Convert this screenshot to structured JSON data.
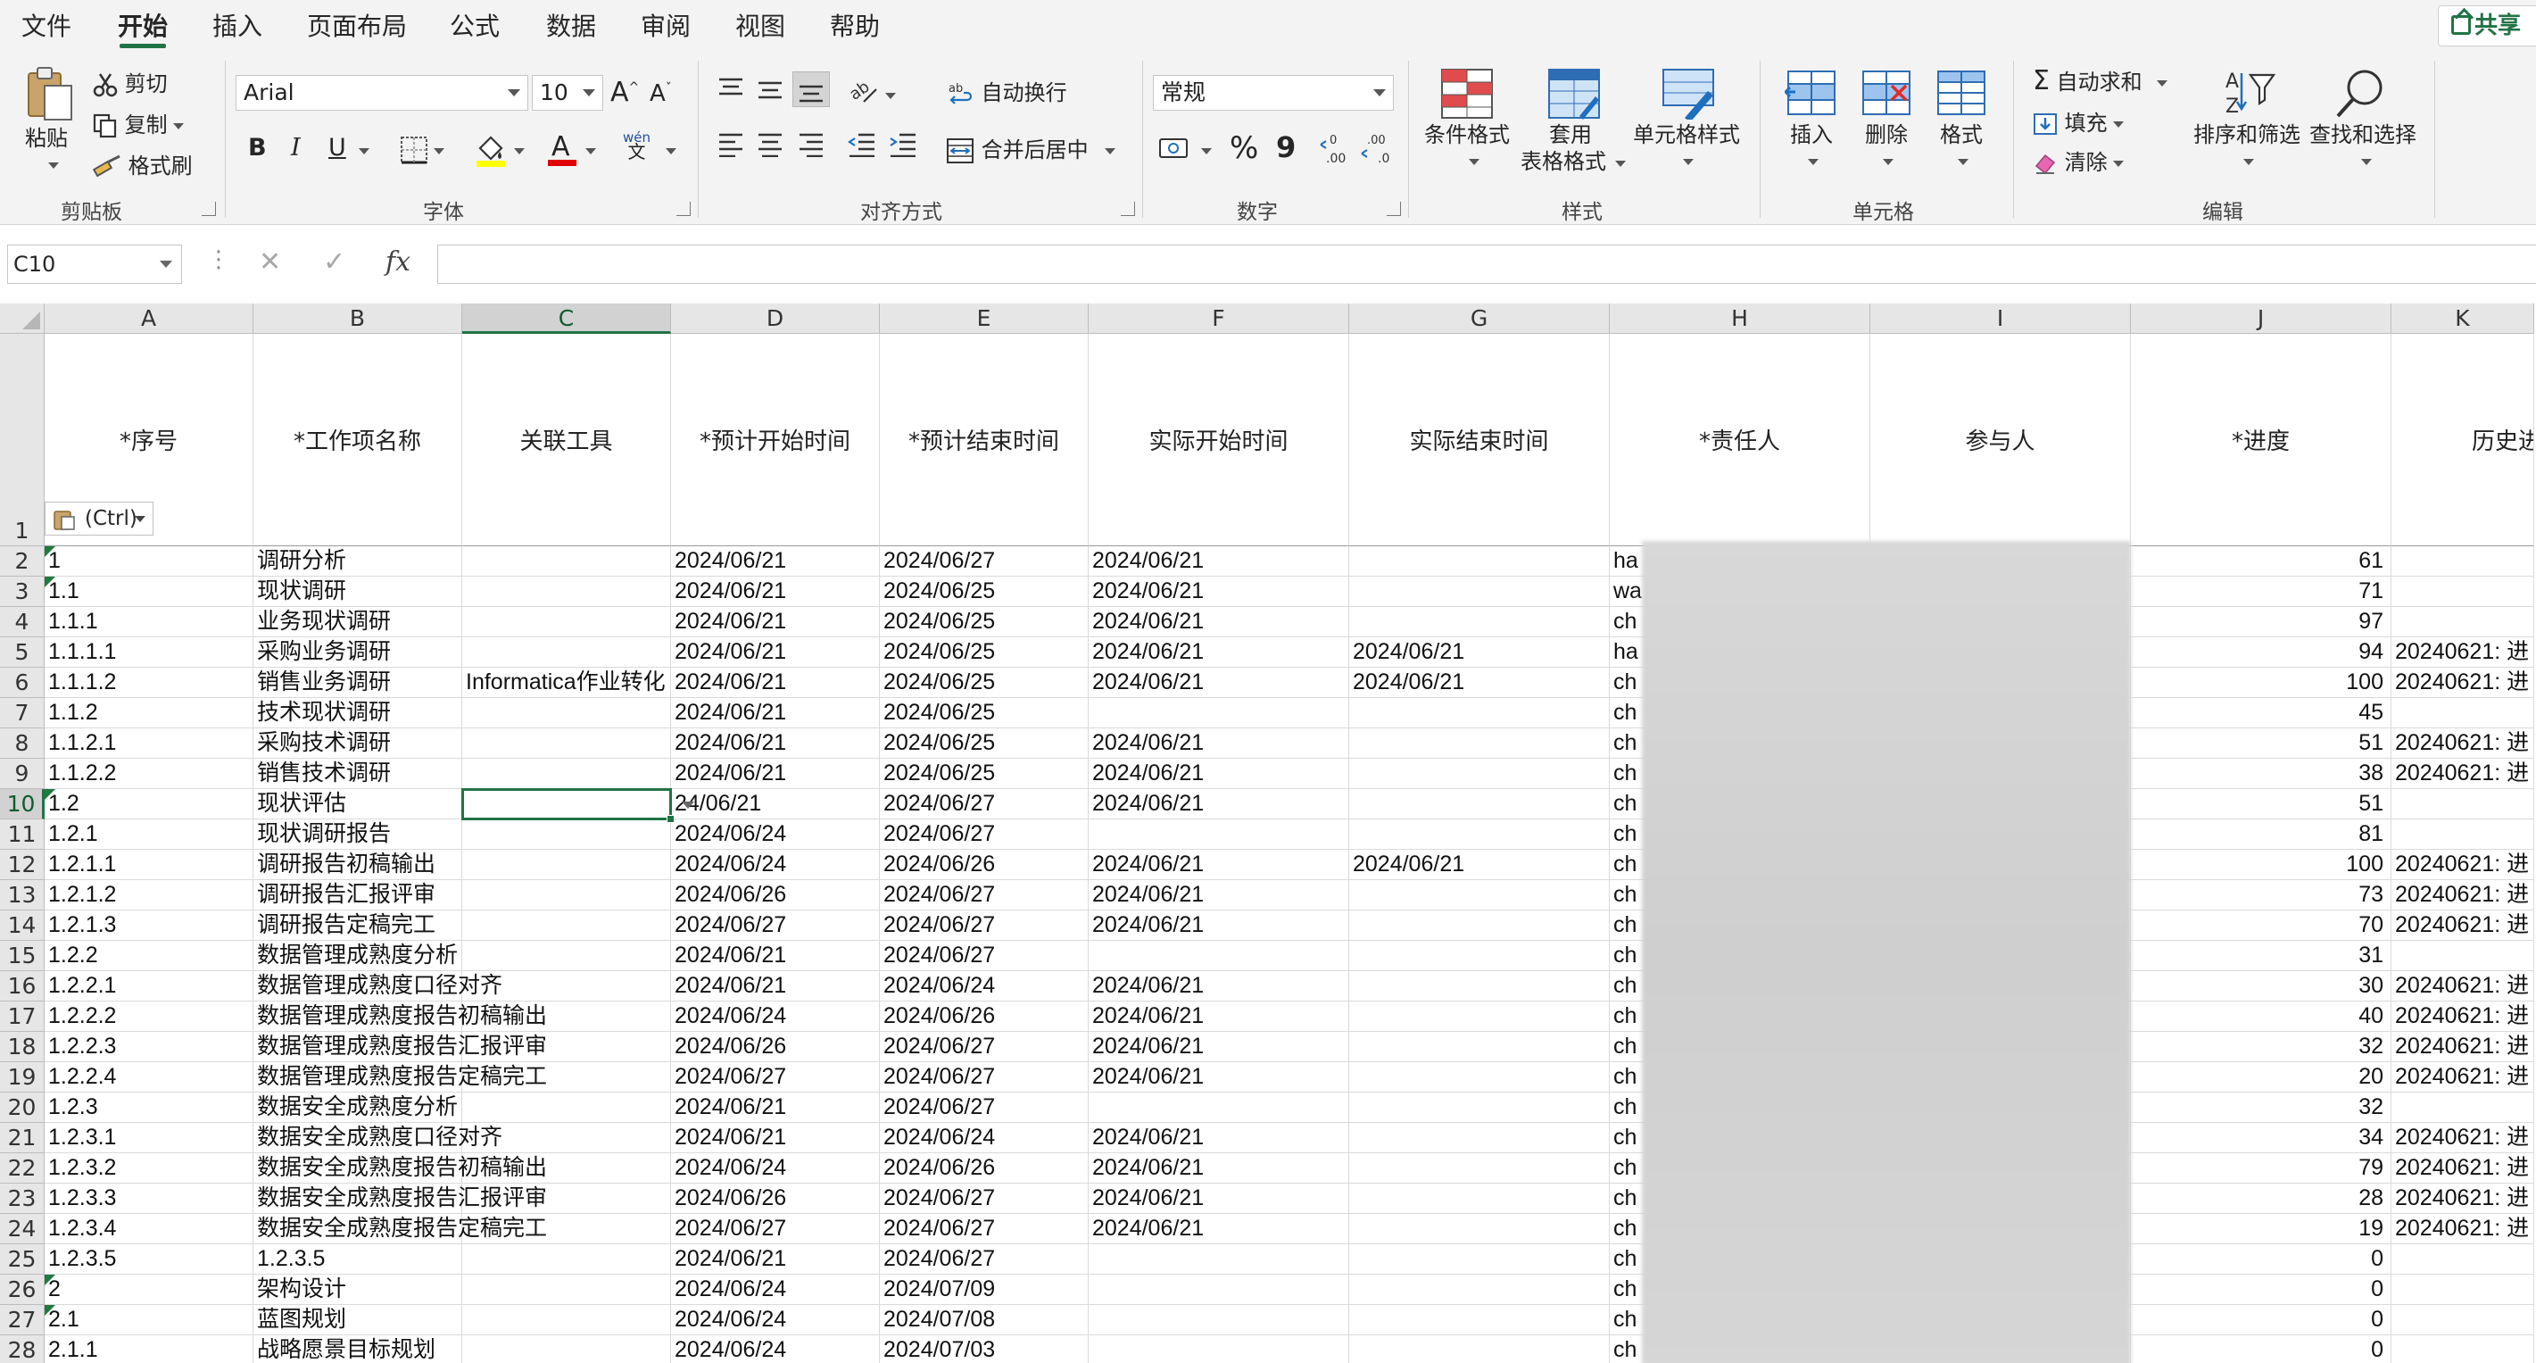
{
  "menu": {
    "tabs": [
      "文件",
      "开始",
      "插入",
      "页面布局",
      "公式",
      "数据",
      "审阅",
      "视图",
      "帮助"
    ],
    "active": "开始",
    "share": "共享"
  },
  "ribbon": {
    "clipboard": {
      "label": "剪贴板",
      "paste": "粘贴",
      "cut": "剪切",
      "copy": "复制",
      "format_painter": "格式刷"
    },
    "font": {
      "label": "字体",
      "font_name": "Arial",
      "font_size": "10",
      "bold": "B",
      "italic": "I",
      "underline": "U",
      "phonetic": "wén"
    },
    "alignment": {
      "label": "对齐方式",
      "wrap": "自动换行",
      "merge": "合并后居中"
    },
    "number": {
      "label": "数字",
      "format": "常规",
      "percent": "%",
      "comma": "9"
    },
    "styles": {
      "label": "样式",
      "conditional": "条件格式",
      "table_a": "套用",
      "table_b": "表格格式",
      "cell_styles": "单元格样式"
    },
    "cells": {
      "label": "单元格",
      "insert": "插入",
      "delete": "删除",
      "format": "格式"
    },
    "editing": {
      "label": "编辑",
      "autosum": "自动求和",
      "fill": "填充",
      "clear": "清除",
      "sort": "排序和筛选",
      "find": "查找和选择"
    }
  },
  "formula_bar": {
    "name_box": "C10",
    "fx": "fx",
    "content": ""
  },
  "sheet": {
    "selected_cell": "C10",
    "columns": [
      "A",
      "B",
      "C",
      "D",
      "E",
      "F",
      "G",
      "H",
      "I",
      "J",
      "K"
    ],
    "header_row": [
      "*序号",
      "*工作项名称",
      "关联工具",
      "*预计开始时间",
      "*预计结束时间",
      "实际开始时间",
      "实际结束时间",
      "*责任人",
      "参与人",
      "*进度",
      "历史进"
    ],
    "paste_ctrl": "(Ctrl)",
    "rows": [
      {
        "n": "2",
        "a": "1",
        "b": "调研分析",
        "c": "",
        "d": "2024/06/21",
        "e": "2024/06/27",
        "f": "2024/06/21",
        "g": "",
        "h": "ha",
        "j": "61",
        "k": "",
        "tri": true
      },
      {
        "n": "3",
        "a": "1.1",
        "b": "现状调研",
        "c": "",
        "d": "2024/06/21",
        "e": "2024/06/25",
        "f": "2024/06/21",
        "g": "",
        "h": "wa",
        "j": "71",
        "k": "",
        "tri": true
      },
      {
        "n": "4",
        "a": "1.1.1",
        "b": "业务现状调研",
        "c": "",
        "d": "2024/06/21",
        "e": "2024/06/25",
        "f": "2024/06/21",
        "g": "",
        "h": "ch",
        "j": "97",
        "k": ""
      },
      {
        "n": "5",
        "a": "1.1.1.1",
        "b": "采购业务调研",
        "c": "",
        "d": "2024/06/21",
        "e": "2024/06/25",
        "f": "2024/06/21",
        "g": "2024/06/21",
        "h": "ha",
        "j": "94",
        "k": "20240621: 进"
      },
      {
        "n": "6",
        "a": "1.1.1.2",
        "b": "销售业务调研",
        "c": "Informatica作业转化",
        "d": "2024/06/21",
        "e": "2024/06/25",
        "f": "2024/06/21",
        "g": "2024/06/21",
        "h": "ch",
        "j": "100",
        "k": "20240621: 进"
      },
      {
        "n": "7",
        "a": "1.1.2",
        "b": "技术现状调研",
        "c": "",
        "d": "2024/06/21",
        "e": "2024/06/25",
        "f": "",
        "g": "",
        "h": "ch",
        "j": "45",
        "k": ""
      },
      {
        "n": "8",
        "a": "1.1.2.1",
        "b": "采购技术调研",
        "c": "",
        "d": "2024/06/21",
        "e": "2024/06/25",
        "f": "2024/06/21",
        "g": "",
        "h": "ch",
        "j": "51",
        "k": "20240621: 进"
      },
      {
        "n": "9",
        "a": "1.1.2.2",
        "b": "销售技术调研",
        "c": "",
        "d": "2024/06/21",
        "e": "2024/06/25",
        "f": "2024/06/21",
        "g": "",
        "h": "ch",
        "j": "38",
        "k": "20240621: 进"
      },
      {
        "n": "10",
        "a": "1.2",
        "b": "现状评估",
        "c": "",
        "d": "24/06/21",
        "e": "2024/06/27",
        "f": "2024/06/21",
        "g": "",
        "h": "ch",
        "j": "51",
        "k": "",
        "tri": true
      },
      {
        "n": "11",
        "a": "1.2.1",
        "b": "现状调研报告",
        "c": "",
        "d": "2024/06/24",
        "e": "2024/06/27",
        "f": "",
        "g": "",
        "h": "ch",
        "j": "81",
        "k": ""
      },
      {
        "n": "12",
        "a": "1.2.1.1",
        "b": "调研报告初稿输出",
        "c": "",
        "d": "2024/06/24",
        "e": "2024/06/26",
        "f": "2024/06/21",
        "g": "2024/06/21",
        "h": "ch",
        "j": "100",
        "k": "20240621: 进"
      },
      {
        "n": "13",
        "a": "1.2.1.2",
        "b": "调研报告汇报评审",
        "c": "",
        "d": "2024/06/26",
        "e": "2024/06/27",
        "f": "2024/06/21",
        "g": "",
        "h": "ch",
        "j": "73",
        "k": "20240621: 进"
      },
      {
        "n": "14",
        "a": "1.2.1.3",
        "b": "调研报告定稿完工",
        "c": "",
        "d": "2024/06/27",
        "e": "2024/06/27",
        "f": "2024/06/21",
        "g": "",
        "h": "ch",
        "j": "70",
        "k": "20240621: 进"
      },
      {
        "n": "15",
        "a": "1.2.2",
        "b": "数据管理成熟度分析",
        "c": "",
        "d": "2024/06/21",
        "e": "2024/06/27",
        "f": "",
        "g": "",
        "h": "ch",
        "j": "31",
        "k": ""
      },
      {
        "n": "16",
        "a": "1.2.2.1",
        "b": "数据管理成熟度口径对齐",
        "c": "",
        "d": "2024/06/21",
        "e": "2024/06/24",
        "f": "2024/06/21",
        "g": "",
        "h": "ch",
        "j": "30",
        "k": "20240621: 进"
      },
      {
        "n": "17",
        "a": "1.2.2.2",
        "b": "数据管理成熟度报告初稿输出",
        "c": "",
        "d": "2024/06/24",
        "e": "2024/06/26",
        "f": "2024/06/21",
        "g": "",
        "h": "ch",
        "j": "40",
        "k": "20240621: 进"
      },
      {
        "n": "18",
        "a": "1.2.2.3",
        "b": "数据管理成熟度报告汇报评审",
        "c": "",
        "d": "2024/06/26",
        "e": "2024/06/27",
        "f": "2024/06/21",
        "g": "",
        "h": "ch",
        "j": "32",
        "k": "20240621: 进"
      },
      {
        "n": "19",
        "a": "1.2.2.4",
        "b": "数据管理成熟度报告定稿完工",
        "c": "",
        "d": "2024/06/27",
        "e": "2024/06/27",
        "f": "2024/06/21",
        "g": "",
        "h": "ch",
        "j": "20",
        "k": "20240621: 进"
      },
      {
        "n": "20",
        "a": "1.2.3",
        "b": "数据安全成熟度分析",
        "c": "",
        "d": "2024/06/21",
        "e": "2024/06/27",
        "f": "",
        "g": "",
        "h": "ch",
        "j": "32",
        "k": ""
      },
      {
        "n": "21",
        "a": "1.2.3.1",
        "b": "数据安全成熟度口径对齐",
        "c": "",
        "d": "2024/06/21",
        "e": "2024/06/24",
        "f": "2024/06/21",
        "g": "",
        "h": "ch",
        "j": "34",
        "k": "20240621: 进"
      },
      {
        "n": "22",
        "a": "1.2.3.2",
        "b": "数据安全成熟度报告初稿输出",
        "c": "",
        "d": "2024/06/24",
        "e": "2024/06/26",
        "f": "2024/06/21",
        "g": "",
        "h": "ch",
        "j": "79",
        "k": "20240621: 进"
      },
      {
        "n": "23",
        "a": "1.2.3.3",
        "b": "数据安全成熟度报告汇报评审",
        "c": "",
        "d": "2024/06/26",
        "e": "2024/06/27",
        "f": "2024/06/21",
        "g": "",
        "h": "ch",
        "j": "28",
        "k": "20240621: 进"
      },
      {
        "n": "24",
        "a": "1.2.3.4",
        "b": "数据安全成熟度报告定稿完工",
        "c": "",
        "d": "2024/06/27",
        "e": "2024/06/27",
        "f": "2024/06/21",
        "g": "",
        "h": "ch",
        "j": "19",
        "k": "20240621: 进"
      },
      {
        "n": "25",
        "a": "1.2.3.5",
        "b": "1.2.3.5",
        "c": "",
        "d": "2024/06/21",
        "e": "2024/06/27",
        "f": "",
        "g": "",
        "h": "ch",
        "j": "0",
        "k": ""
      },
      {
        "n": "26",
        "a": "2",
        "b": "架构设计",
        "c": "",
        "d": "2024/06/24",
        "e": "2024/07/09",
        "f": "",
        "g": "",
        "h": "ch",
        "j": "0",
        "k": "",
        "tri": true
      },
      {
        "n": "27",
        "a": "2.1",
        "b": "蓝图规划",
        "c": "",
        "d": "2024/06/24",
        "e": "2024/07/08",
        "f": "",
        "g": "",
        "h": "ch",
        "j": "0",
        "k": "",
        "tri": true
      },
      {
        "n": "28",
        "a": "2.1.1",
        "b": "战略愿景目标规划",
        "c": "",
        "d": "2024/06/24",
        "e": "2024/07/03",
        "f": "",
        "g": "",
        "h": "ch",
        "j": "0",
        "k": ""
      }
    ]
  }
}
